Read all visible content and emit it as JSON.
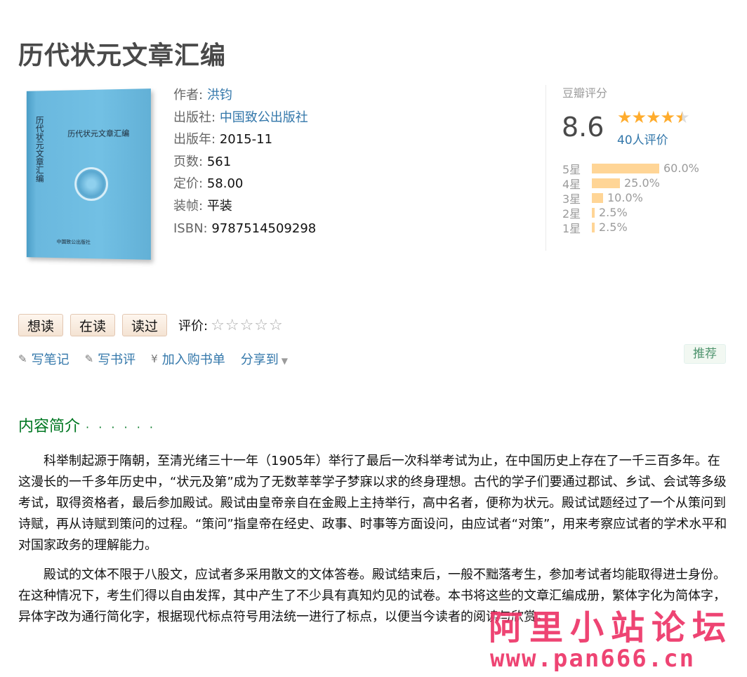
{
  "book": {
    "title": "历代状元文章汇编",
    "cover": {
      "spine_text": "历代状元文章汇编",
      "title_text": "历代状元文章汇编",
      "publisher_text": "中国致公出版社"
    },
    "info": {
      "author_label": "作者:",
      "author": "洪钧",
      "publisher_label": "出版社:",
      "publisher": "中国致公出版社",
      "year_label": "出版年:",
      "year": "2015-11",
      "pages_label": "页数:",
      "pages": "561",
      "price_label": "定价:",
      "price": "58.00",
      "binding_label": "装帧:",
      "binding": "平装",
      "isbn_label": "ISBN:",
      "isbn": "9787514509298"
    }
  },
  "rating": {
    "label": "豆瓣评分",
    "score": "8.6",
    "stars": 4.5,
    "count": "40人评价",
    "distribution": [
      {
        "label": "5星",
        "percent": "60.0%",
        "value": 60.0
      },
      {
        "label": "4星",
        "percent": "25.0%",
        "value": 25.0
      },
      {
        "label": "3星",
        "percent": "10.0%",
        "value": 10.0
      },
      {
        "label": "2星",
        "percent": "2.5%",
        "value": 2.5
      },
      {
        "label": "1星",
        "percent": "2.5%",
        "value": 2.5
      }
    ]
  },
  "actions": {
    "want": "想读",
    "reading": "在读",
    "read": "读过",
    "rate_label": "评价:",
    "rate_stars": "☆☆☆☆☆"
  },
  "links": {
    "note": "写笔记",
    "review": "写书评",
    "cart": "加入购书单",
    "share": "分享到",
    "recommend": "推荐"
  },
  "intro": {
    "title": "内容简介",
    "dots": "· · · · · ·",
    "paragraphs": [
      "科举制起源于隋朝，至清光绪三十一年（1905年）举行了最后一次科举考试为止，在中国历史上存在了一千三百多年。在这漫长的一千多年历史中，“状元及第”成为了无数莘莘学子梦寐以求的终身理想。古代的学子们要通过郡试、乡试、会试等多级考试，取得资格者，最后参加殿试。殿试由皇帝亲自在金殿上主持举行，高中名者，便称为状元。殿试试题经过了一个从策问到诗赋，再从诗赋到策问的过程。“策问”指皇帝在经史、政事、时事等方面设问，由应试者“对策”，用来考察应试者的学术水平和对国家政务的理解能力。",
      "殿试的文体不限于八股文，应试者多采用散文的文体答卷。殿试结束后，一般不黜落考生，参加考试者均能取得进士身份。在这种情况下，考生们得以自由发挥，其中产生了不少具有真知灼见的试卷。本书将这些的文章汇编成册，繁体字化为简体字，异体字改为通行简化字，根据现代标点符号用法统一进行了标点，以便当今读者的阅读与欣赏。"
    ]
  },
  "watermark": {
    "line1": "阿里小站论坛",
    "line2": "www.pan666.cn"
  },
  "colors": {
    "link": "#3377aa",
    "star": "#ffac2d",
    "bar": "#ffd596",
    "section": "#007722",
    "watermark": "#ec2a60"
  }
}
